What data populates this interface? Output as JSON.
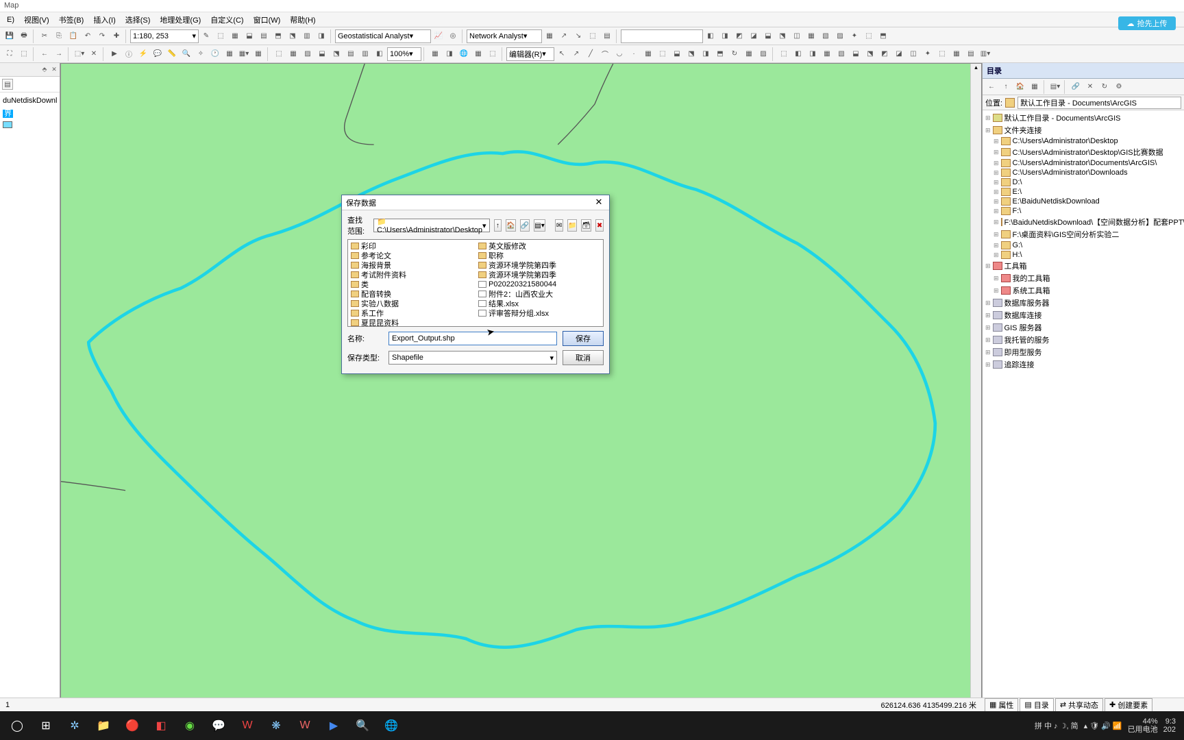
{
  "title": "Map",
  "menu": [
    "E)",
    "视图(V)",
    "书签(B)",
    "插入(I)",
    "选择(S)",
    "地理处理(G)",
    "自定义(C)",
    "窗口(W)",
    "帮助(H)"
  ],
  "toolbar1": {
    "scale": "1:180, 253",
    "geo_label": "Geostatistical Analyst",
    "net_label": "Network Analyst"
  },
  "toolbar2": {
    "zoom_pct": "100%",
    "editor_label": "编辑器(R)"
  },
  "toc": {
    "pin": "⬘",
    "close": "✕",
    "layer_name": "duNetdiskDownlo",
    "layer2": "界"
  },
  "catalog": {
    "title": "目录",
    "loc_label": "位置:",
    "loc_value": "默认工作目录 - Documents\\ArcGIS",
    "tree": [
      {
        "t": "默认工作目录 - Documents\\ArcGIS",
        "i": 0,
        "ic": "home"
      },
      {
        "t": "文件夹连接",
        "i": 0,
        "ic": "fold"
      },
      {
        "t": "C:\\Users\\Administrator\\Desktop",
        "i": 1,
        "ic": "fold"
      },
      {
        "t": "C:\\Users\\Administrator\\Desktop\\GIS比赛数据",
        "i": 1,
        "ic": "fold"
      },
      {
        "t": "C:\\Users\\Administrator\\Documents\\ArcGIS\\",
        "i": 1,
        "ic": "fold"
      },
      {
        "t": "C:\\Users\\Administrator\\Downloads",
        "i": 1,
        "ic": "fold"
      },
      {
        "t": "D:\\",
        "i": 1,
        "ic": "fold"
      },
      {
        "t": "E:\\",
        "i": 1,
        "ic": "fold"
      },
      {
        "t": "E:\\BaiduNetdiskDownload",
        "i": 1,
        "ic": "fold"
      },
      {
        "t": "F:\\",
        "i": 1,
        "ic": "fold"
      },
      {
        "t": "F:\\BaiduNetdiskDownload\\【空间数据分析】配套PPT\\【空",
        "i": 1,
        "ic": "fold"
      },
      {
        "t": "F:\\桌面资料\\GIS空间分析实验二",
        "i": 1,
        "ic": "fold"
      },
      {
        "t": "G:\\",
        "i": 1,
        "ic": "fold"
      },
      {
        "t": "H:\\",
        "i": 1,
        "ic": "fold"
      },
      {
        "t": "工具箱",
        "i": 0,
        "ic": "tbx"
      },
      {
        "t": "我的工具箱",
        "i": 1,
        "ic": "tbx"
      },
      {
        "t": "系统工具箱",
        "i": 1,
        "ic": "tbx"
      },
      {
        "t": "数据库服务器",
        "i": 0,
        "ic": "db"
      },
      {
        "t": "数据库连接",
        "i": 0,
        "ic": "db"
      },
      {
        "t": "GIS 服务器",
        "i": 0,
        "ic": "srv"
      },
      {
        "t": "我托管的服务",
        "i": 0,
        "ic": "srv"
      },
      {
        "t": "即用型服务",
        "i": 0,
        "ic": "srv"
      },
      {
        "t": "追踪连接",
        "i": 0,
        "ic": "srv"
      }
    ]
  },
  "status": {
    "left": "1",
    "coords": "626124.636 4135499.216 米",
    "tabs": [
      "属性",
      "目录",
      "共享动态",
      "创建要素"
    ]
  },
  "dialog": {
    "title": "保存数据",
    "range_label": "查找范围:",
    "range_path": "C:\\Users\\Administrator\\Desktop",
    "col1": [
      "彩印",
      "参考论文",
      "海报背景",
      "考试附件资料",
      "类",
      "配音转换",
      "实验八数据",
      "系工作",
      "夏昆昆资料"
    ],
    "col2": [
      {
        "n": "英文版修改",
        "k": "f"
      },
      {
        "n": "职称",
        "k": "f"
      },
      {
        "n": "资源环境学院第四季",
        "k": "f"
      },
      {
        "n": "资源环境学院第四季",
        "k": "f"
      },
      {
        "n": "P020220321580044",
        "k": "x"
      },
      {
        "n": "附件2：山西农业大",
        "k": "x"
      },
      {
        "n": "结果.xlsx",
        "k": "x"
      },
      {
        "n": "评审答辩分组.xlsx",
        "k": "x"
      }
    ],
    "name_label": "名称:",
    "name_value": "Export_Output.shp",
    "type_label": "保存类型:",
    "type_value": "Shapefile",
    "save_btn": "保存",
    "cancel_btn": "取消"
  },
  "cloud_btn": "抢先上传",
  "taskbar": {
    "right": "拼 中 ♪ ☽, 简",
    "battery": "44%",
    "battery2": "已用电池",
    "time": "9:3",
    "date": "202"
  }
}
